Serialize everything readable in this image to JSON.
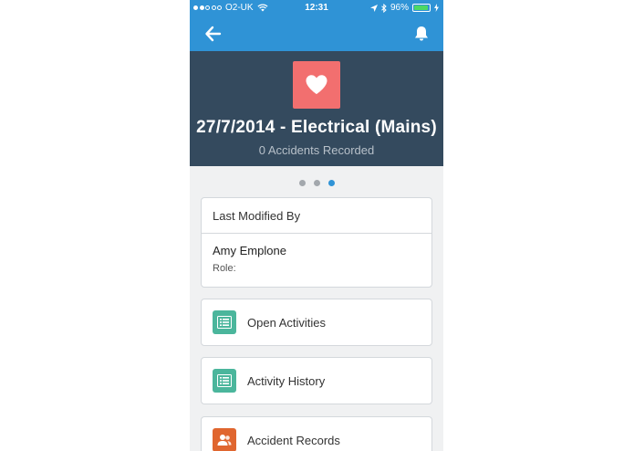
{
  "status_bar": {
    "carrier": "O2-UK",
    "time": "12:31",
    "battery": "96%",
    "battery_level": 0.96,
    "signal_bars_filled": 2,
    "signal_bars_total": 5
  },
  "navbar": {
    "back_icon": "arrow-left-icon",
    "notification_icon": "bell-icon",
    "color": "#2f93d6"
  },
  "header": {
    "icon": "heart-icon",
    "icon_bg": "#f26f6f",
    "title": "27/7/2014 - Electrical (Mains)",
    "subtitle": "0 Accidents Recorded",
    "bg": "#344a5e"
  },
  "pager": {
    "pages": 3,
    "active_index": 2
  },
  "last_modified": {
    "heading": "Last Modified By",
    "name": "Amy Emplone",
    "role_label": "Role:"
  },
  "related_lists": [
    {
      "label": "Open Activities",
      "icon": "list-icon",
      "color": "#4bb69c"
    },
    {
      "label": "Activity History",
      "icon": "list-icon",
      "color": "#4bb69c"
    },
    {
      "label": "Accident Records",
      "icon": "people-icon",
      "color": "#e0662f"
    }
  ]
}
